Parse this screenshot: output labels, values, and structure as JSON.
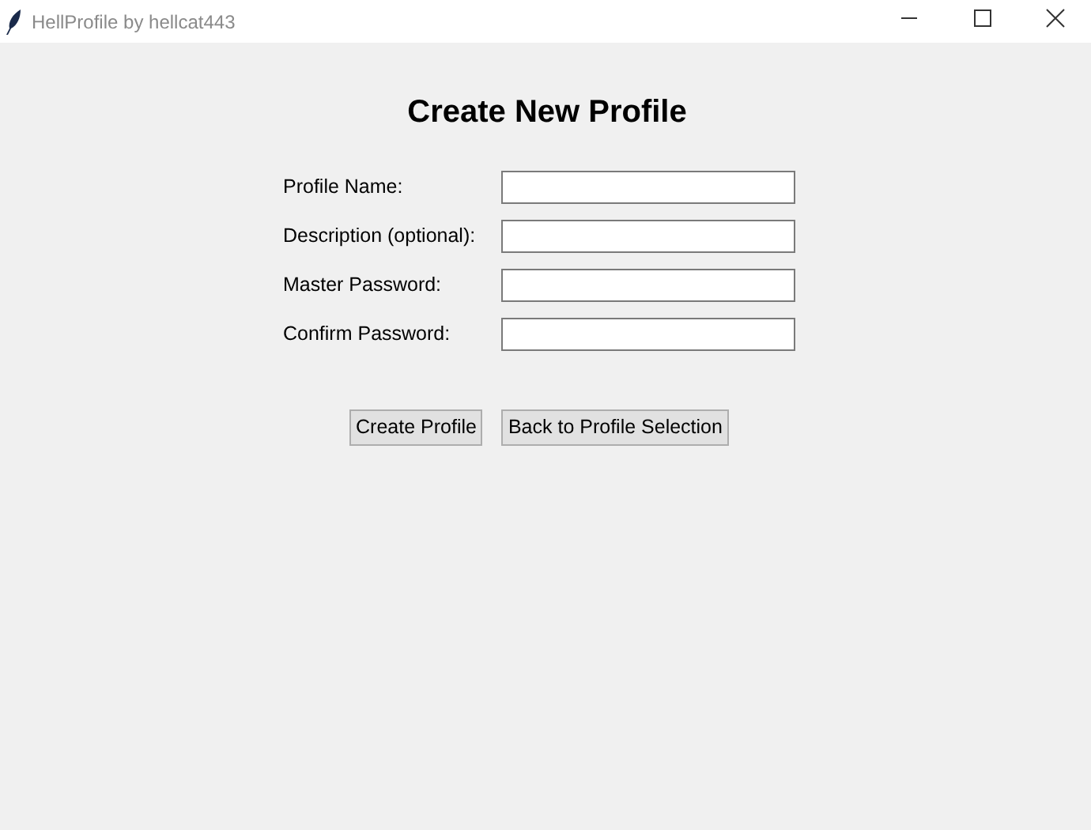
{
  "window": {
    "title": "HellProfile by hellcat443"
  },
  "heading": "Create New Profile",
  "fields": [
    {
      "label": "Profile Name:"
    },
    {
      "label": "Description (optional):"
    },
    {
      "label": "Master Password:"
    },
    {
      "label": "Confirm Password:"
    }
  ],
  "buttons": [
    "Create Profile",
    "Back to Profile Selection"
  ]
}
